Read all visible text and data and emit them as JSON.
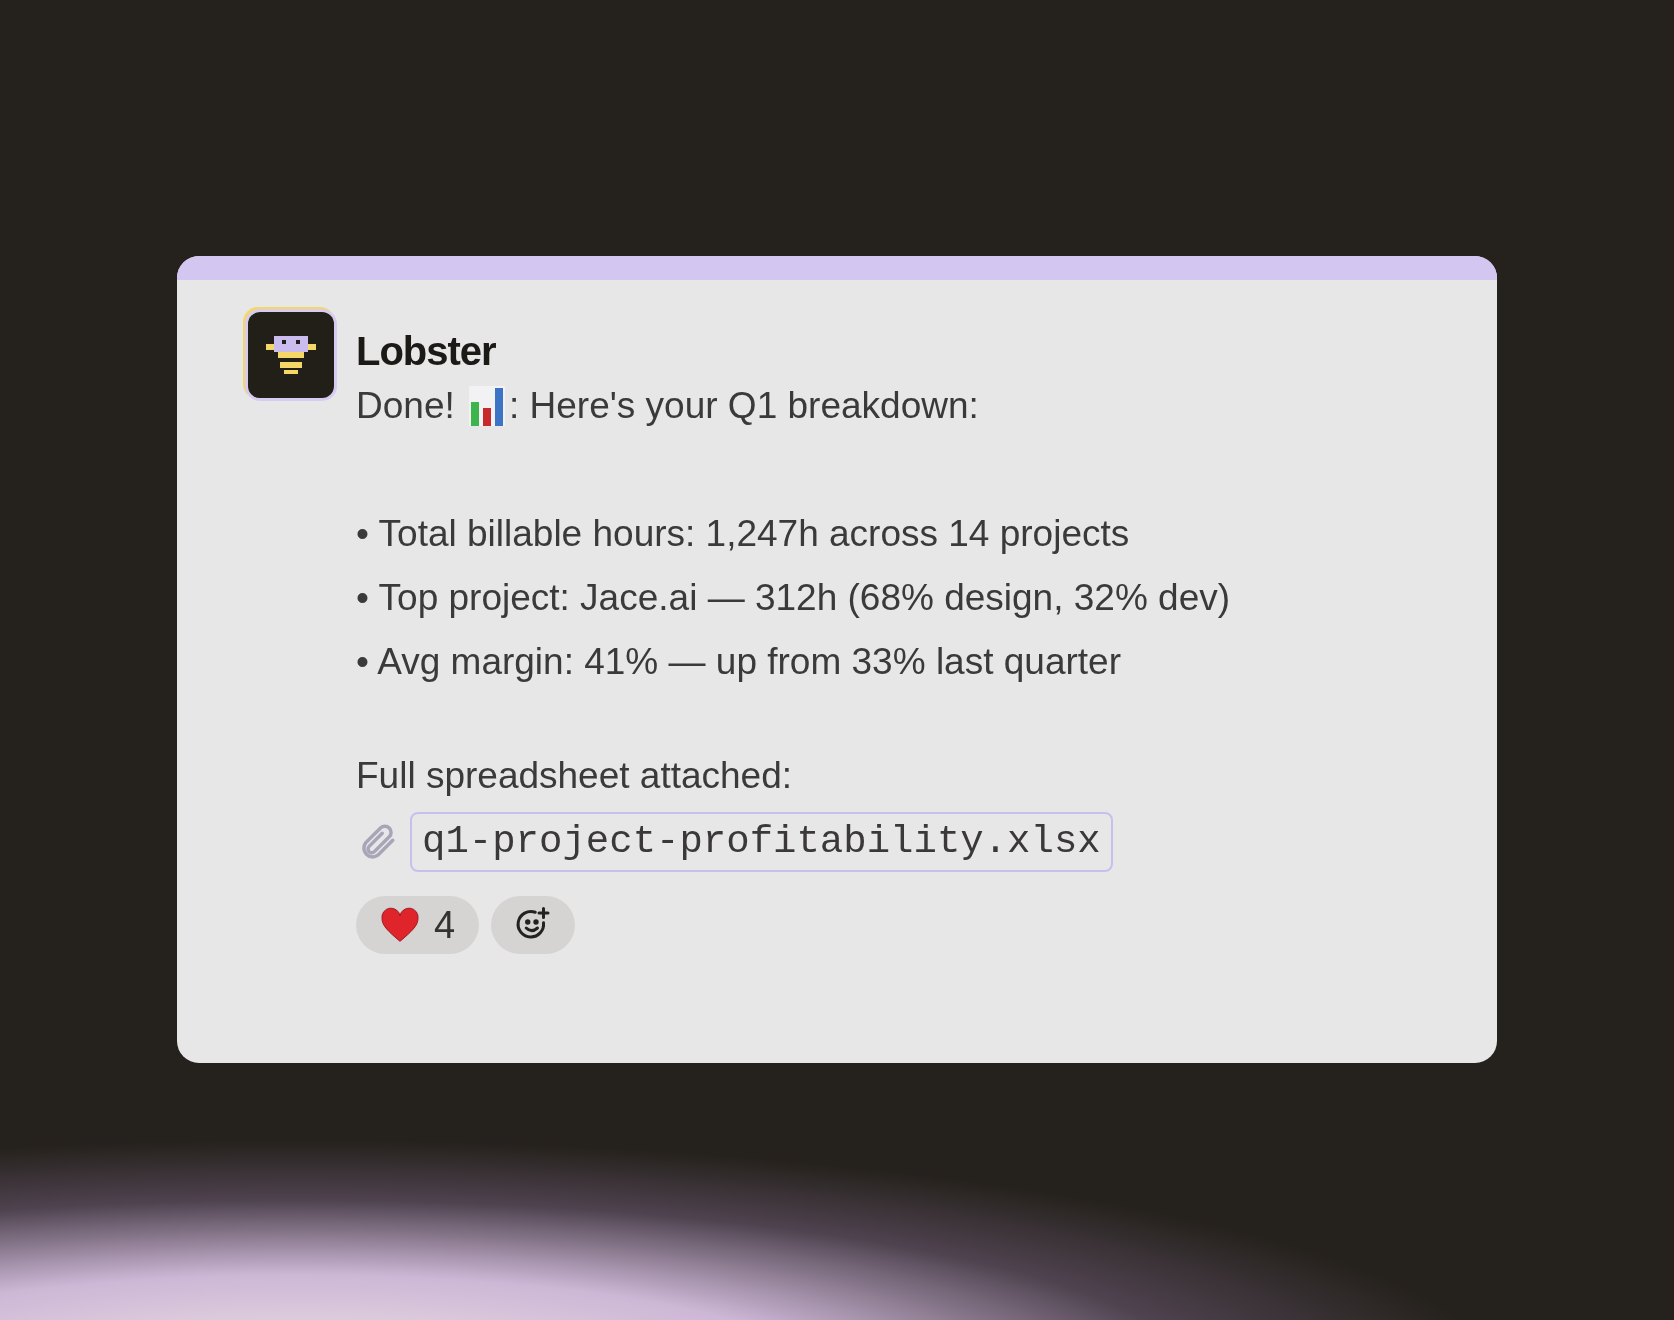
{
  "message": {
    "author": "Lobster",
    "intro": {
      "before": "Done!",
      "after": ": Here's your Q1 breakdown:"
    },
    "bullets": [
      "• Total billable hours: 1,247h across 14 projects",
      "• Top project: Jace.ai — 312h (68% design, 32% dev)",
      "• Avg margin: 41% — up from 33% last quarter"
    ],
    "attachment_intro": "Full spreadsheet attached:",
    "attachment": {
      "filename": "q1-project-profitability.xlsx"
    },
    "reactions": [
      {
        "kind": "heart",
        "count": "4"
      },
      {
        "kind": "add"
      }
    ]
  }
}
